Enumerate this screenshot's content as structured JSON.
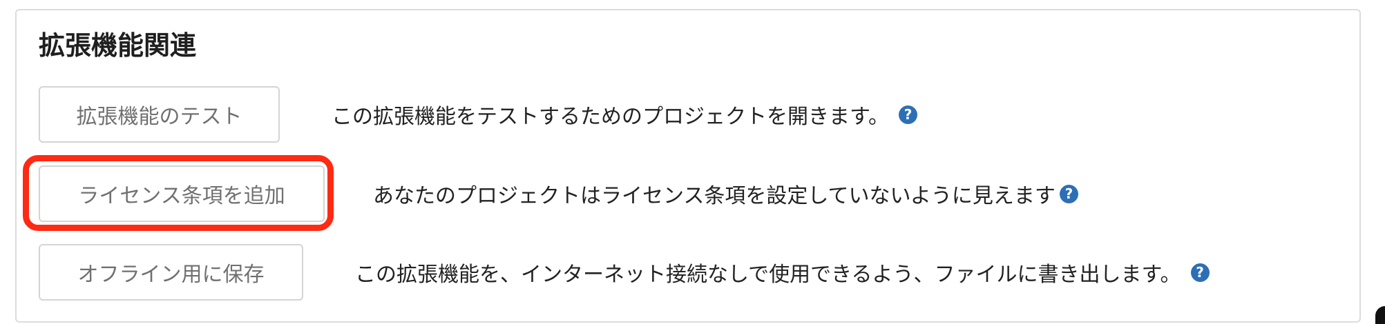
{
  "section": {
    "title": "拡張機能関連"
  },
  "rows": [
    {
      "button_label": "拡張機能のテスト",
      "description": "この拡張機能をテストするためのプロジェクトを開きます。",
      "help_glyph": "?"
    },
    {
      "button_label": "ライセンス条項を追加",
      "description": "あなたのプロジェクトはライセンス条項を設定していないように見えます",
      "help_glyph": "?"
    },
    {
      "button_label": "オフライン用に保存",
      "description": "この拡張機能を、インターネット接続なしで使用できるよう、ファイルに書き出します。",
      "help_glyph": "?"
    }
  ],
  "colors": {
    "highlight": "#ff2a14",
    "help_icon": "#2d6fb5"
  }
}
